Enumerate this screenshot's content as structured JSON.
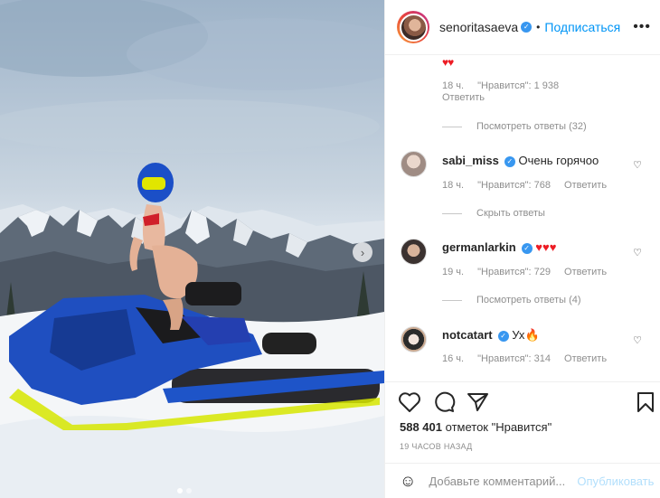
{
  "header": {
    "username": "senoritasaeva",
    "dot": "•",
    "follow_label": "Подписаться",
    "more_label": "•••"
  },
  "comments": {
    "first_reply": {
      "emoji": "♥♥",
      "time": "18 ч.",
      "likes": "\"Нравится\": 1 938",
      "reply_label": "Ответить"
    },
    "view_replies_1": "Посмотреть ответы (32)",
    "items": [
      {
        "username": "sabi_miss",
        "text": "Очень горячоо ",
        "time": "18 ч.",
        "likes": "\"Нравится\": 768",
        "reply_label": "Ответить"
      },
      {
        "username": "germanlarkin",
        "text": "♥♥♥",
        "time": "19 ч.",
        "likes": "\"Нравится\": 729",
        "reply_label": "Ответить"
      },
      {
        "username": "notcatart",
        "text": "Ух",
        "time": "16 ч.",
        "likes": "\"Нравится\": 314",
        "reply_label": "Ответить"
      }
    ],
    "hide_replies": "Скрыть ответы",
    "view_replies_2": "Посмотреть ответы (4)"
  },
  "actions": {
    "likes_count": "588 401",
    "likes_suffix": "отметок \"Нравится\"",
    "time_ago": "19 ЧАСОВ НАЗАД"
  },
  "add_comment": {
    "placeholder": "Добавьте комментарий...",
    "post_label": "Опубликовать"
  },
  "carousel": {
    "arrow": "›",
    "slides": 2,
    "active": 1
  },
  "colors": {
    "accent": "#0095f6",
    "verified": "#3897f0",
    "heart_red": "#ed1c24"
  },
  "icons": [
    "verified-icon",
    "more-icon",
    "heart-icon",
    "comment-icon",
    "share-icon",
    "bookmark-icon",
    "smile-icon",
    "chevron-right-icon"
  ]
}
